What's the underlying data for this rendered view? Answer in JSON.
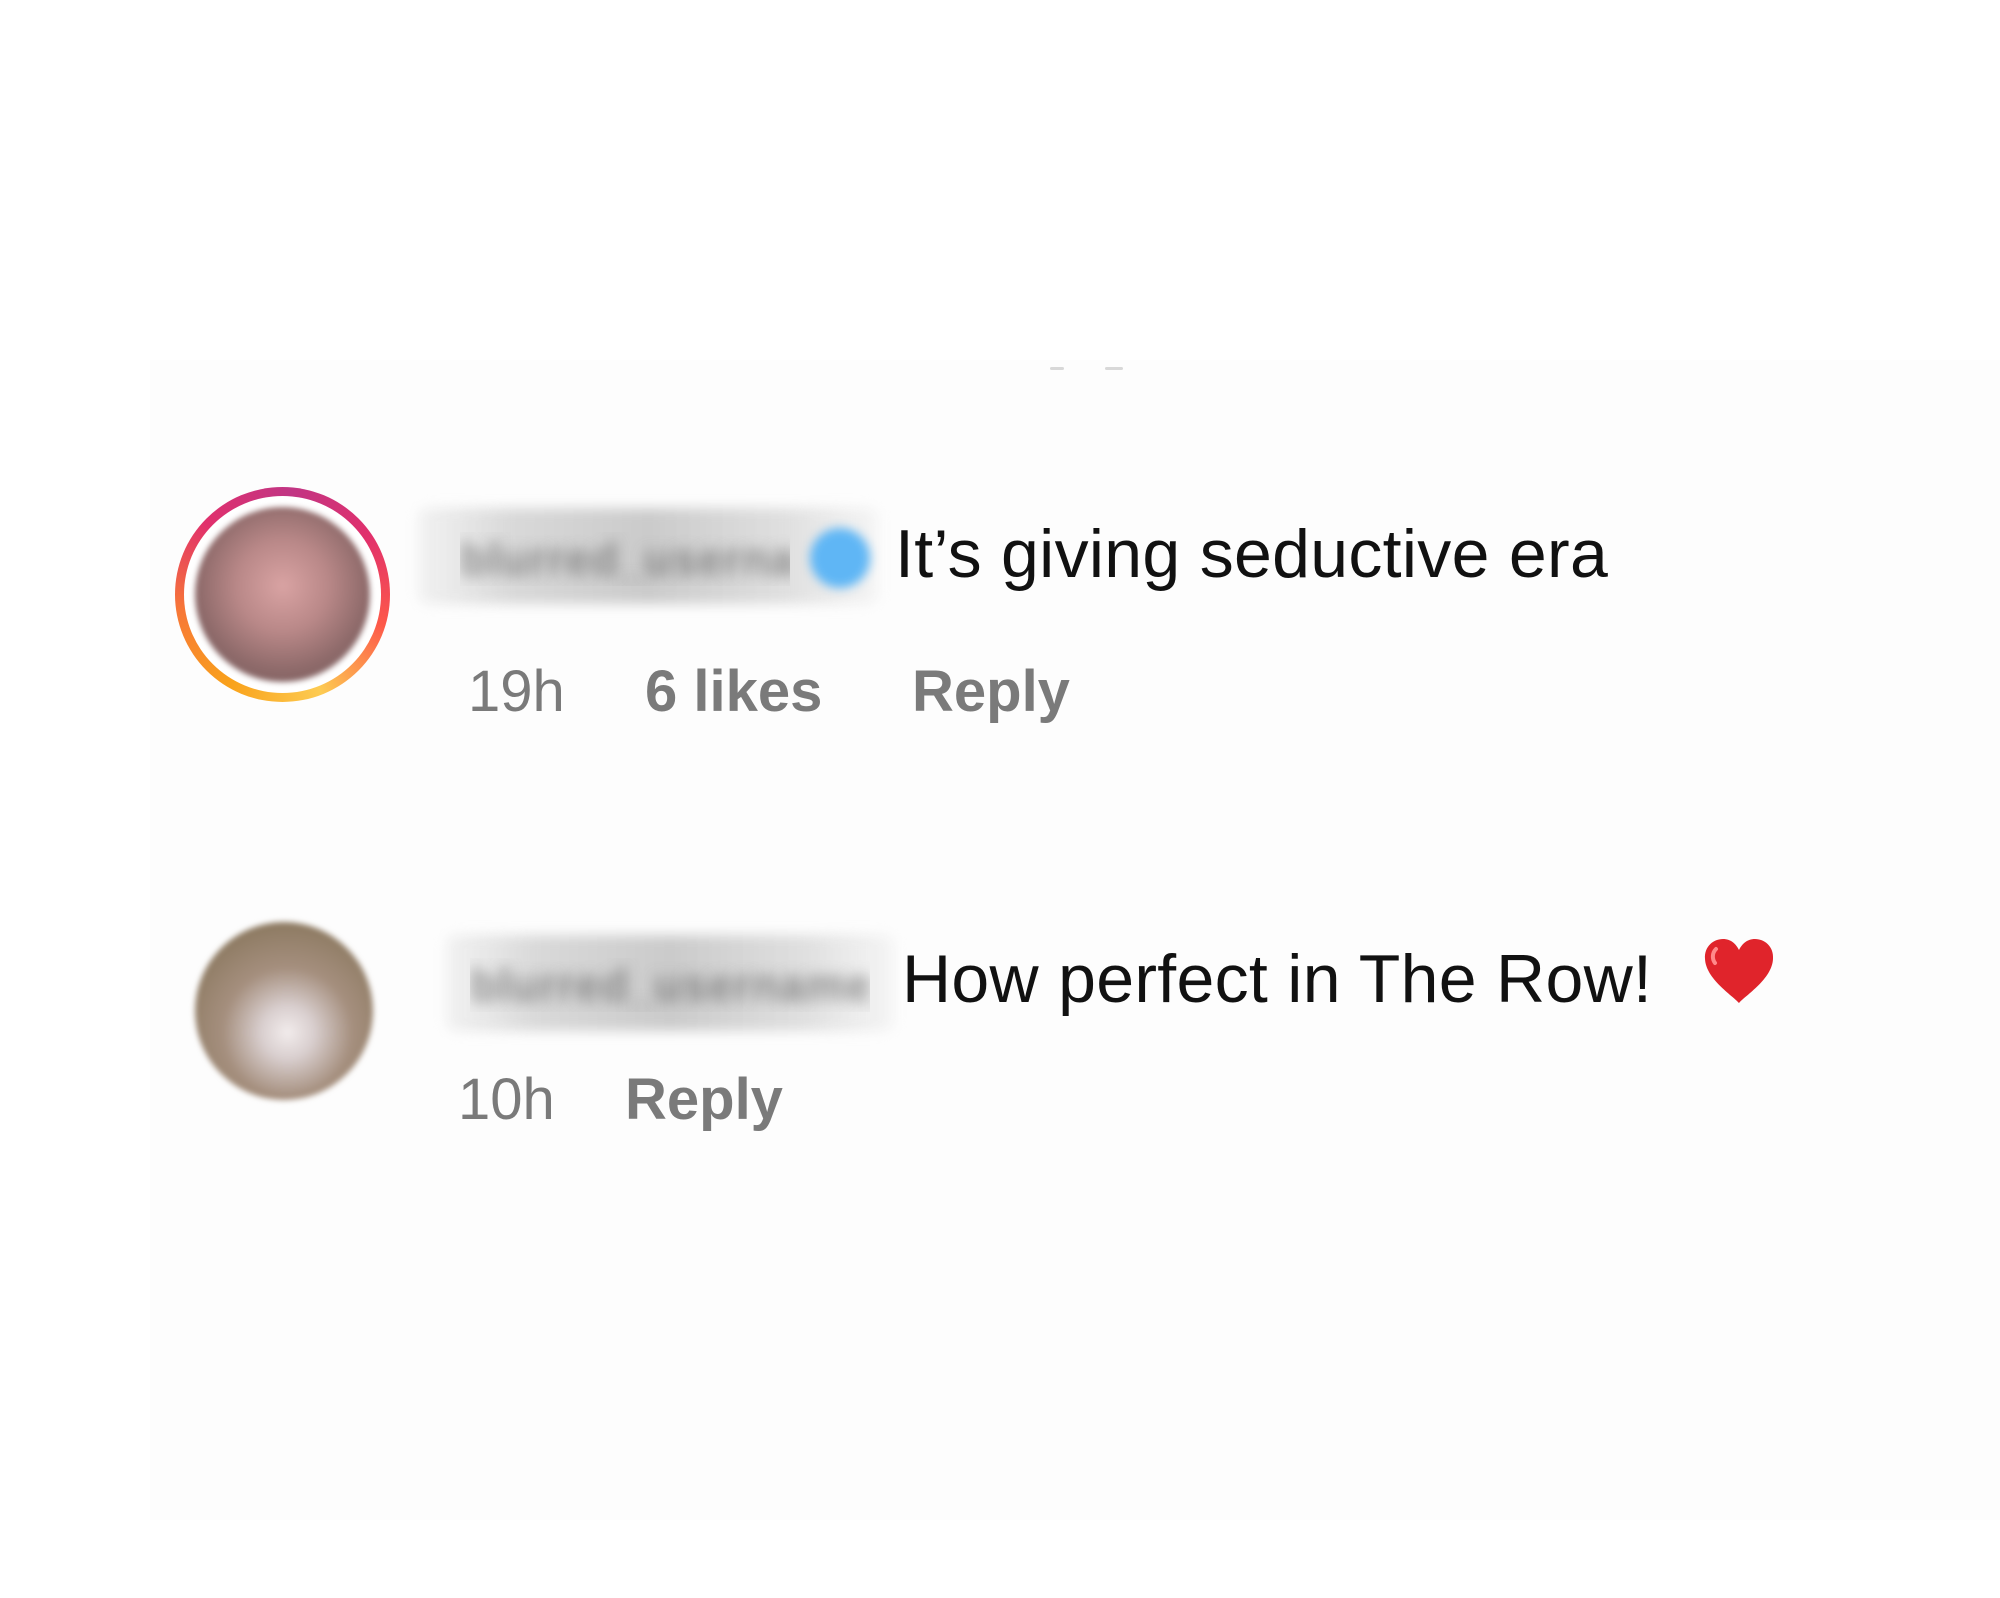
{
  "comments": [
    {
      "username": "blurred_username_one",
      "verified": true,
      "has_story_ring": true,
      "text": "It’s giving seductive era",
      "time": "19h",
      "likes": "6 likes",
      "reply_label": "Reply"
    },
    {
      "username": "blurred_username_two",
      "verified": false,
      "has_story_ring": false,
      "text": "How perfect in The Row!",
      "emoji": "heart-icon",
      "time": "10h",
      "reply_label": "Reply"
    }
  ],
  "colors": {
    "comment_text": "#111111",
    "meta_text": "#7a7a7a",
    "verified_badge": "#5fb6f5",
    "heart": "#e0242b"
  }
}
